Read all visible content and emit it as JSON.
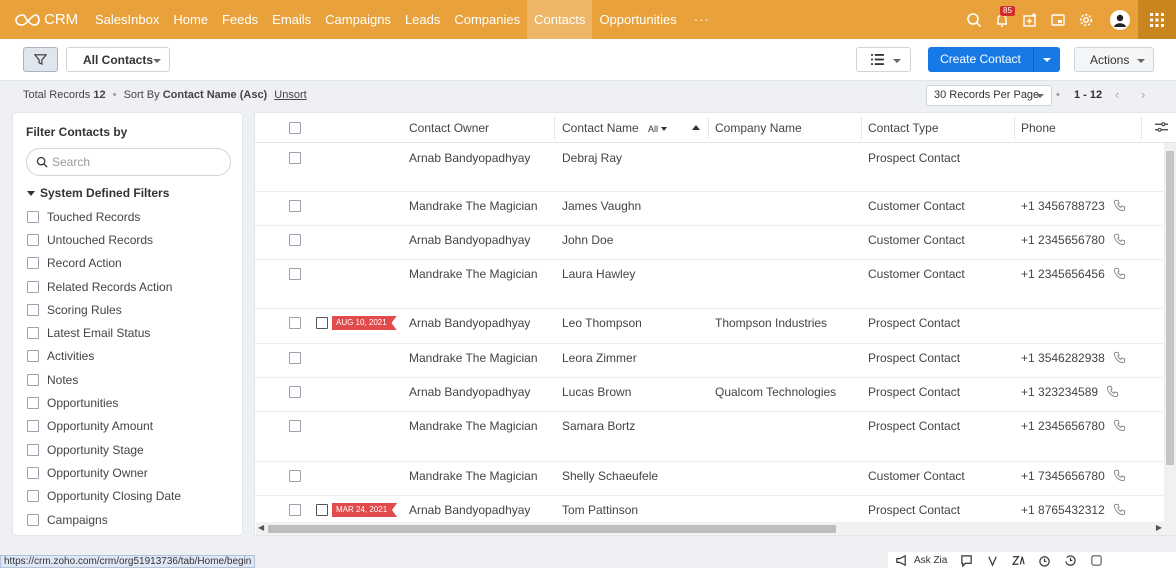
{
  "app": {
    "logo_text": "CRM"
  },
  "nav": {
    "items": [
      {
        "label": "SalesInbox",
        "active": false
      },
      {
        "label": "Home",
        "active": false
      },
      {
        "label": "Feeds",
        "active": false
      },
      {
        "label": "Emails",
        "active": false
      },
      {
        "label": "Campaigns",
        "active": false
      },
      {
        "label": "Leads",
        "active": false
      },
      {
        "label": "Companies",
        "active": false
      },
      {
        "label": "Contacts",
        "active": true
      },
      {
        "label": "Opportunities",
        "active": false
      }
    ],
    "more": "···",
    "notification_count": "85",
    "colors": {
      "bar": "#e9a23b",
      "apps": "#c9861e"
    }
  },
  "toolbar": {
    "view_label": "All Contacts",
    "create_label": "Create Contact",
    "actions_label": "Actions",
    "create_color": "#1679e5"
  },
  "records": {
    "total_label": "Total Records",
    "total": "12",
    "sort_by_label": "Sort By",
    "sort_field": "Contact Name (Asc)",
    "unsort": "Unsort",
    "per_page": "30 Records Per Page",
    "range": "1 - 12"
  },
  "filters": {
    "title": "Filter Contacts by",
    "search_placeholder": "Search",
    "section": "System Defined Filters",
    "items": [
      "Touched Records",
      "Untouched Records",
      "Record Action",
      "Related Records Action",
      "Scoring Rules",
      "Latest Email Status",
      "Activities",
      "Notes",
      "Opportunities",
      "Opportunity Amount",
      "Opportunity Stage",
      "Opportunity Owner",
      "Opportunity Closing Date",
      "Campaigns"
    ]
  },
  "table": {
    "columns": {
      "owner": "Contact Owner",
      "name": "Contact Name",
      "name_filter": "All",
      "company": "Company Name",
      "type": "Contact Type",
      "phone": "Phone"
    },
    "rows": [
      {
        "owner": "Arnab Bandyopadhyay",
        "name": "Debraj Ray",
        "company": "",
        "type": "Prospect Contact",
        "phone": "",
        "tag": ""
      },
      {
        "owner": "Mandrake The Magician",
        "name": "James Vaughn",
        "company": "",
        "type": "Customer Contact",
        "phone": "+1 3456788723",
        "tag": ""
      },
      {
        "owner": "Arnab Bandyopadhyay",
        "name": "John Doe",
        "company": "",
        "type": "Customer Contact",
        "phone": "+1 2345656780",
        "tag": ""
      },
      {
        "owner": "Mandrake The Magician",
        "name": "Laura Hawley",
        "company": "",
        "type": "Customer Contact",
        "phone": "+1 2345656456",
        "tag": ""
      },
      {
        "owner": "Arnab Bandyopadhyay",
        "name": "Leo Thompson",
        "company": "Thompson Industries",
        "type": "Prospect Contact",
        "phone": "",
        "tag": "AUG 10, 2021"
      },
      {
        "owner": "Mandrake The Magician",
        "name": "Leora Zimmer",
        "company": "",
        "type": "Prospect Contact",
        "phone": "+1 3546282938",
        "tag": ""
      },
      {
        "owner": "Arnab Bandyopadhyay",
        "name": "Lucas Brown",
        "company": "Qualcom Technologies",
        "type": "Prospect Contact",
        "phone": "+1 323234589",
        "tag": ""
      },
      {
        "owner": "Mandrake The Magician",
        "name": "Samara Bortz",
        "company": "",
        "type": "Prospect Contact",
        "phone": "+1 2345656780",
        "tag": ""
      },
      {
        "owner": "Mandrake The Magician",
        "name": "Shelly Schaeufele",
        "company": "",
        "type": "Customer Contact",
        "phone": "+1 7345656780",
        "tag": ""
      },
      {
        "owner": "Arnab Bandyopadhyay",
        "name": "Tom Pattinson",
        "company": "",
        "type": "Prospect Contact",
        "phone": "+1 8765432312",
        "tag": "MAR 24, 2021"
      }
    ]
  },
  "status_url": "https://crm.zoho.com/crm/org51913736/tab/Home/begin",
  "bottom": {
    "ask_zia": "Ask Zia"
  }
}
